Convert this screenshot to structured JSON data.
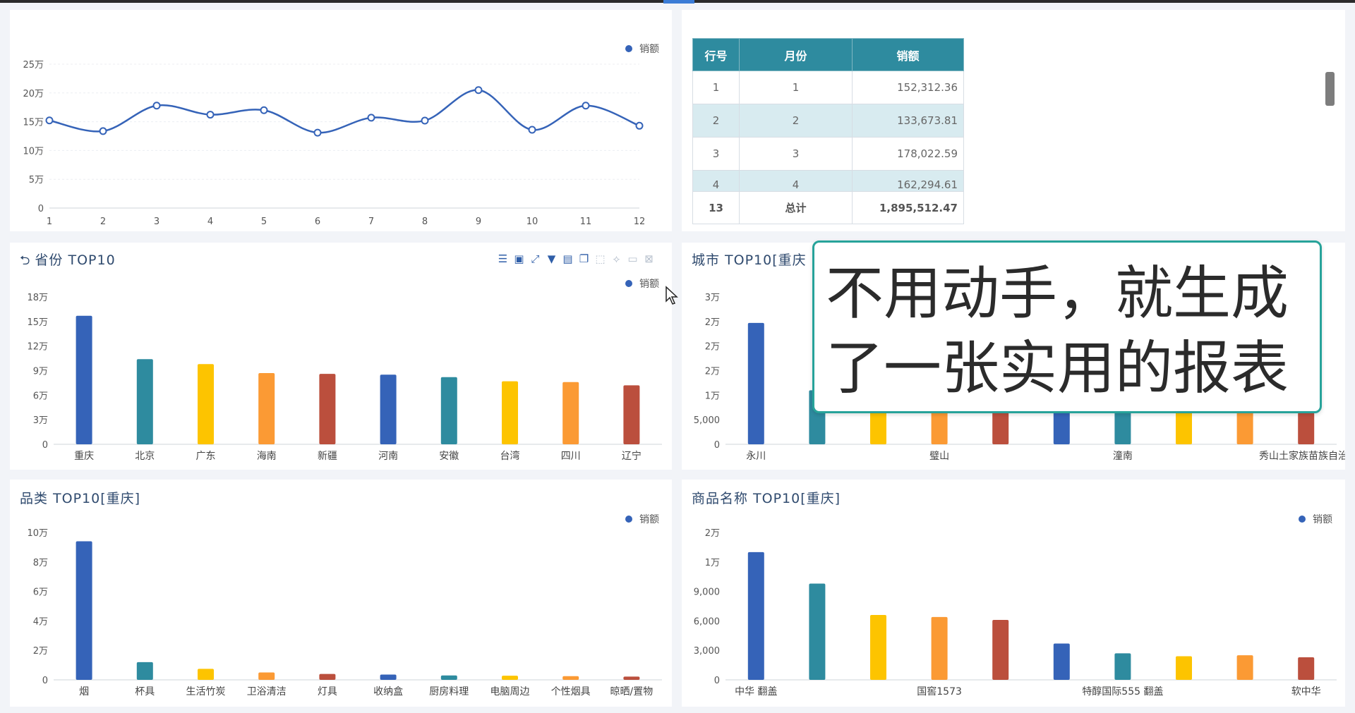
{
  "colors": {
    "palette": [
      "#3563b8",
      "#2e8b9f",
      "#fdc400",
      "#fb9a34",
      "#bb4f3d"
    ],
    "line": "#3563b8",
    "table_header": "#2e8b9f",
    "caption_border": "#27a39a"
  },
  "caption": {
    "line1": "不用动手，就生成",
    "line2": "了一张实用的报表"
  },
  "table": {
    "headers": [
      "行号",
      "月份",
      "销额"
    ],
    "rows": [
      [
        "1",
        "1",
        "152,312.36"
      ],
      [
        "2",
        "2",
        "133,673.81"
      ],
      [
        "3",
        "3",
        "178,022.59"
      ],
      [
        "4",
        "4",
        "162,294.61"
      ]
    ],
    "total": [
      "13",
      "总计",
      "1,895,512.47"
    ]
  },
  "toolbar_icons": [
    "list-icon",
    "grid-icon",
    "expand-icon",
    "filter-icon",
    "export-icon",
    "copy-icon",
    "select-icon",
    "lasso-icon",
    "brush-icon",
    "clear-icon"
  ],
  "panels": {
    "province": {
      "title": "省份 TOP10",
      "back_icon": "⮌"
    },
    "city": {
      "title": "城市 TOP10[重庆"
    },
    "category": {
      "title": "品类 TOP10[重庆]"
    },
    "product": {
      "title": "商品名称 TOP10[重庆]"
    }
  },
  "chart_data": [
    {
      "id": "monthly",
      "type": "line",
      "smooth": true,
      "x": [
        1,
        2,
        3,
        4,
        5,
        6,
        7,
        8,
        9,
        10,
        11,
        12
      ],
      "series": [
        {
          "name": "销额",
          "values": [
            152312.36,
            133673.81,
            178022.59,
            162294.61,
            170000,
            131000,
            157000,
            152000,
            205000,
            136000,
            178000,
            143000
          ]
        }
      ],
      "ylim": [
        0,
        250000
      ],
      "yticks": [
        0,
        50000,
        100000,
        150000,
        200000,
        250000
      ],
      "ytick_labels": [
        "0",
        "5万",
        "10万",
        "15万",
        "20万",
        "25万"
      ],
      "grid": true,
      "legend": "top-right"
    },
    {
      "id": "province",
      "type": "bar",
      "title": "省份 TOP10",
      "categories": [
        "重庆",
        "北京",
        "广东",
        "海南",
        "新疆",
        "河南",
        "安徽",
        "台湾",
        "四川",
        "辽宁"
      ],
      "series": [
        {
          "name": "销额",
          "values": [
            157000,
            104000,
            98000,
            87000,
            86000,
            85000,
            82000,
            77000,
            76000,
            72000
          ]
        }
      ],
      "ylim": [
        0,
        180000
      ],
      "yticks": [
        0,
        30000,
        60000,
        90000,
        120000,
        150000,
        180000
      ],
      "ytick_labels": [
        "0",
        "3万",
        "6万",
        "9万",
        "12万",
        "15万",
        "18万"
      ],
      "legend": "top-right"
    },
    {
      "id": "city",
      "type": "bar",
      "title": "城市 TOP10[重庆",
      "categories": [
        "永川",
        "",
        "",
        "",
        "",
        "璧山",
        "",
        "",
        "潼南",
        "",
        "",
        "秀山土家族苗族自治"
      ],
      "series": [
        {
          "name": "销额",
          "values": [
            24700,
            11000,
            8000,
            8000,
            8000,
            8000,
            7500,
            7000,
            7000,
            6500
          ]
        }
      ],
      "ylim": [
        0,
        30000
      ],
      "yticks": [
        0,
        5000,
        10000,
        15000,
        20000,
        25000,
        30000
      ],
      "ytick_labels": [
        "0",
        "5,000",
        "1万",
        "2万",
        "2万",
        "2万",
        "3万"
      ],
      "xtick_labels": [
        [
          "永川",
          0
        ],
        [
          "璧山",
          3
        ],
        [
          "潼南",
          6
        ],
        [
          "秀山土家族苗族自治",
          9
        ]
      ],
      "legend": "top-right"
    },
    {
      "id": "category",
      "type": "bar",
      "title": "品类 TOP10[重庆]",
      "categories": [
        "烟",
        "杯具",
        "生活竹炭",
        "卫浴清洁",
        "灯具",
        "收纳盒",
        "厨房料理",
        "电脑周边",
        "个性烟具",
        "晾晒/置物"
      ],
      "series": [
        {
          "name": "销额",
          "values": [
            94000,
            12000,
            7500,
            5000,
            4000,
            3600,
            3000,
            2800,
            2500,
            2200
          ]
        }
      ],
      "ylim": [
        0,
        100000
      ],
      "yticks": [
        0,
        20000,
        40000,
        60000,
        80000,
        100000
      ],
      "ytick_labels": [
        "0",
        "2万",
        "4万",
        "6万",
        "8万",
        "10万"
      ],
      "legend": "top-right"
    },
    {
      "id": "product",
      "type": "bar",
      "title": "商品名称 TOP10[重庆]",
      "categories": [
        "中华 翻盖",
        "",
        "",
        "国窖1573",
        "",
        "",
        "特醇国际555 翻盖",
        "",
        "",
        "软中华"
      ],
      "series": [
        {
          "name": "销额",
          "values": [
            13000,
            9800,
            6600,
            6400,
            6100,
            3700,
            2700,
            2400,
            2500,
            2300
          ]
        }
      ],
      "ylim": [
        0,
        15000
      ],
      "yticks": [
        0,
        3000,
        6000,
        9000,
        12000,
        15000
      ],
      "ytick_labels": [
        "0",
        "3,000",
        "6,000",
        "9,000",
        "1万",
        "2万"
      ],
      "xtick_labels": [
        [
          "中华 翻盖",
          0
        ],
        [
          "国窖1573",
          3
        ],
        [
          "特醇国际555 翻盖",
          6
        ],
        [
          "软中华",
          9
        ]
      ],
      "legend": "top-right"
    }
  ]
}
